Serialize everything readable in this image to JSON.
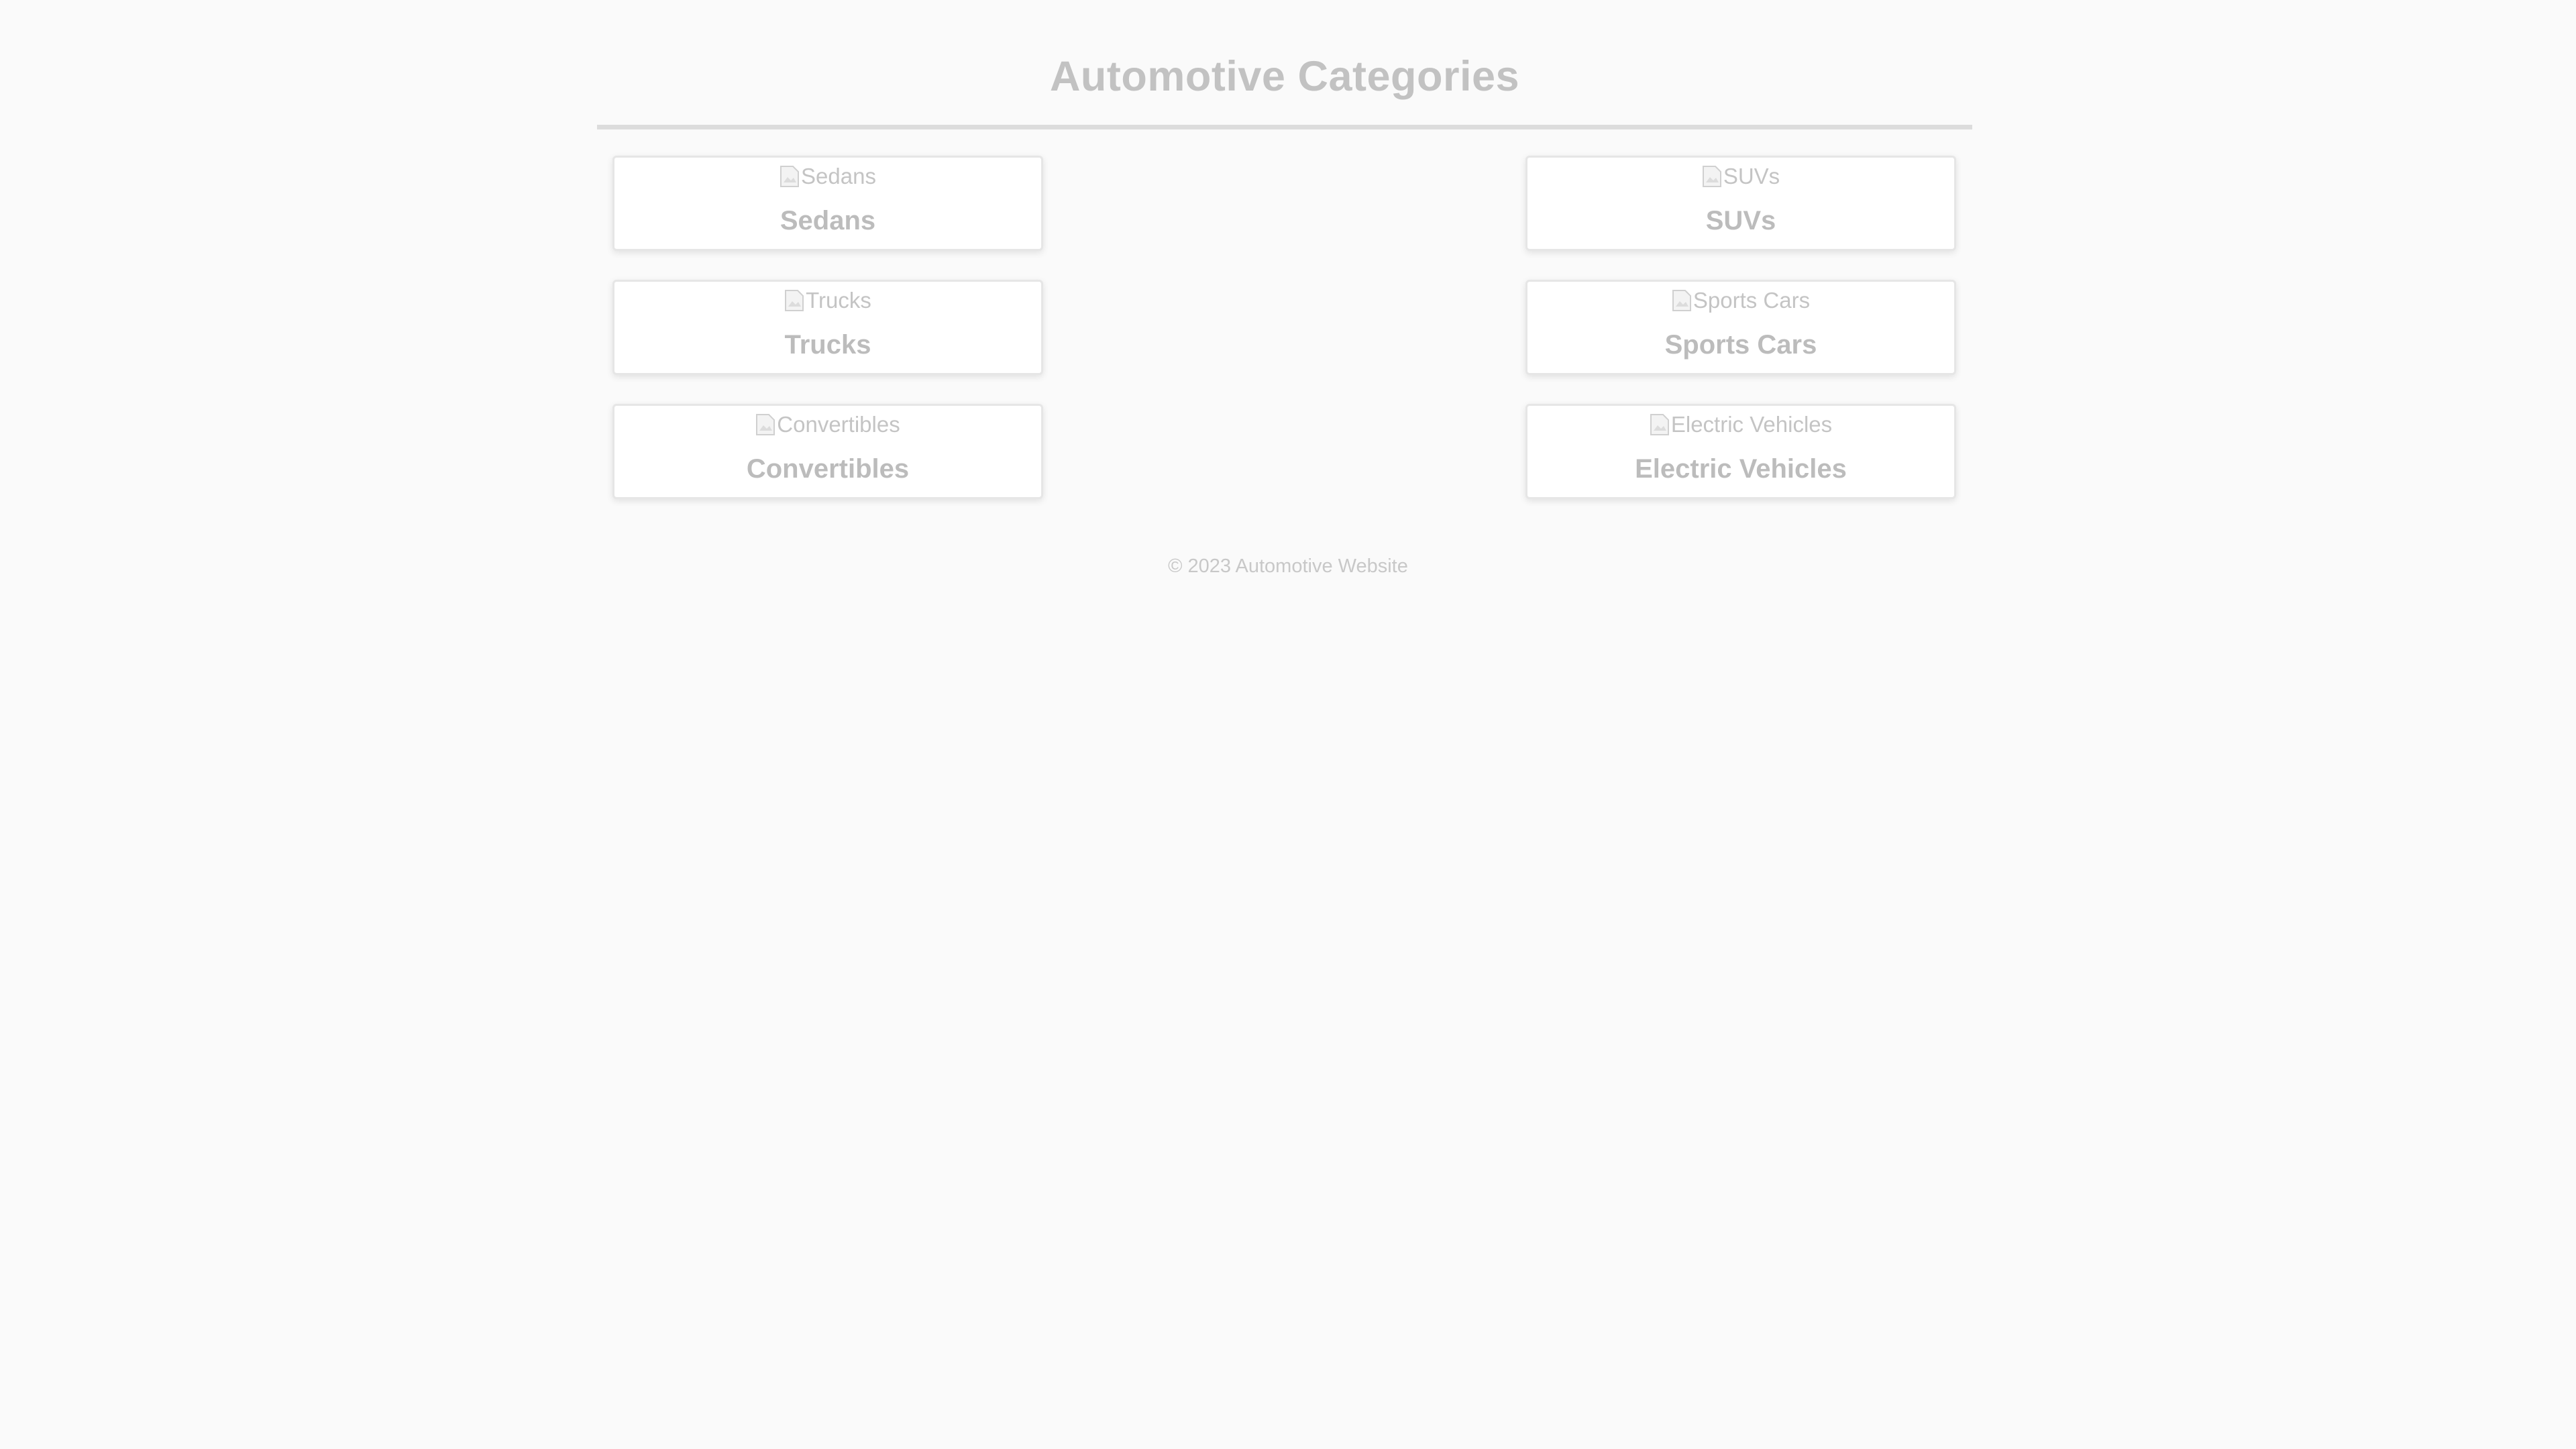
{
  "header": {
    "title": "Automotive Categories"
  },
  "categories": [
    {
      "image_alt": "Sedans",
      "label": "Sedans"
    },
    {
      "image_alt": "SUVs",
      "label": "SUVs"
    },
    {
      "image_alt": "Trucks",
      "label": "Trucks"
    },
    {
      "image_alt": "Sports Cars",
      "label": "Sports Cars"
    },
    {
      "image_alt": "Convertibles",
      "label": "Convertibles"
    },
    {
      "image_alt": "Electric Vehicles",
      "label": "Electric Vehicles"
    }
  ],
  "footer": {
    "copyright": "© 2023 Automotive Website"
  },
  "icons": {
    "image_placeholder": "broken-image-icon"
  },
  "colors": {
    "background": "#fafafa",
    "title_text": "#c2c2c2",
    "card_background": "#ffffff",
    "card_border": "#e6e6e6",
    "divider": "#dcdcdc"
  }
}
